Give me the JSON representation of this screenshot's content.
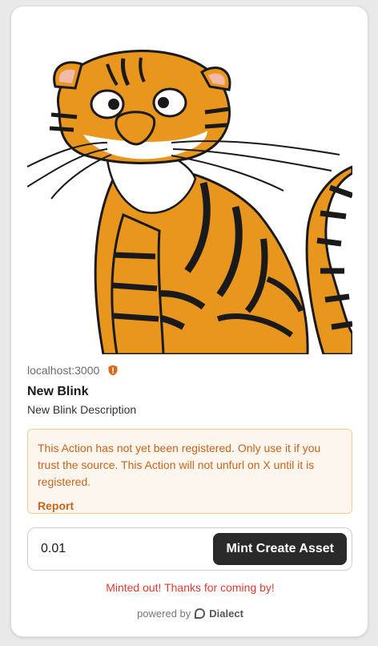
{
  "blink": {
    "host": "localhost:3000",
    "title": "New Blink",
    "description": "New Blink Description"
  },
  "warning": {
    "message": "This Action has not yet been registered. Only use it if you trust the source. This Action will not unfurl on X until it is registered.",
    "report_label": "Report"
  },
  "action": {
    "amount_value": "0.01",
    "button_label": "Mint Create Asset"
  },
  "status": {
    "message": "Minted out! Thanks for coming by!"
  },
  "footer": {
    "powered_by": "powered by",
    "brand": "Dialect"
  },
  "icons": {
    "host_badge": "shield-icon",
    "footer_logo": "dialect-logo-icon"
  },
  "colors": {
    "warning_text": "#c9621a",
    "warning_bg": "#fdf6ee",
    "warning_border": "#f3cd8a",
    "button_bg": "#2a2a2a",
    "status_text": "#e03a2f",
    "tiger_orange": "#e8961e"
  }
}
